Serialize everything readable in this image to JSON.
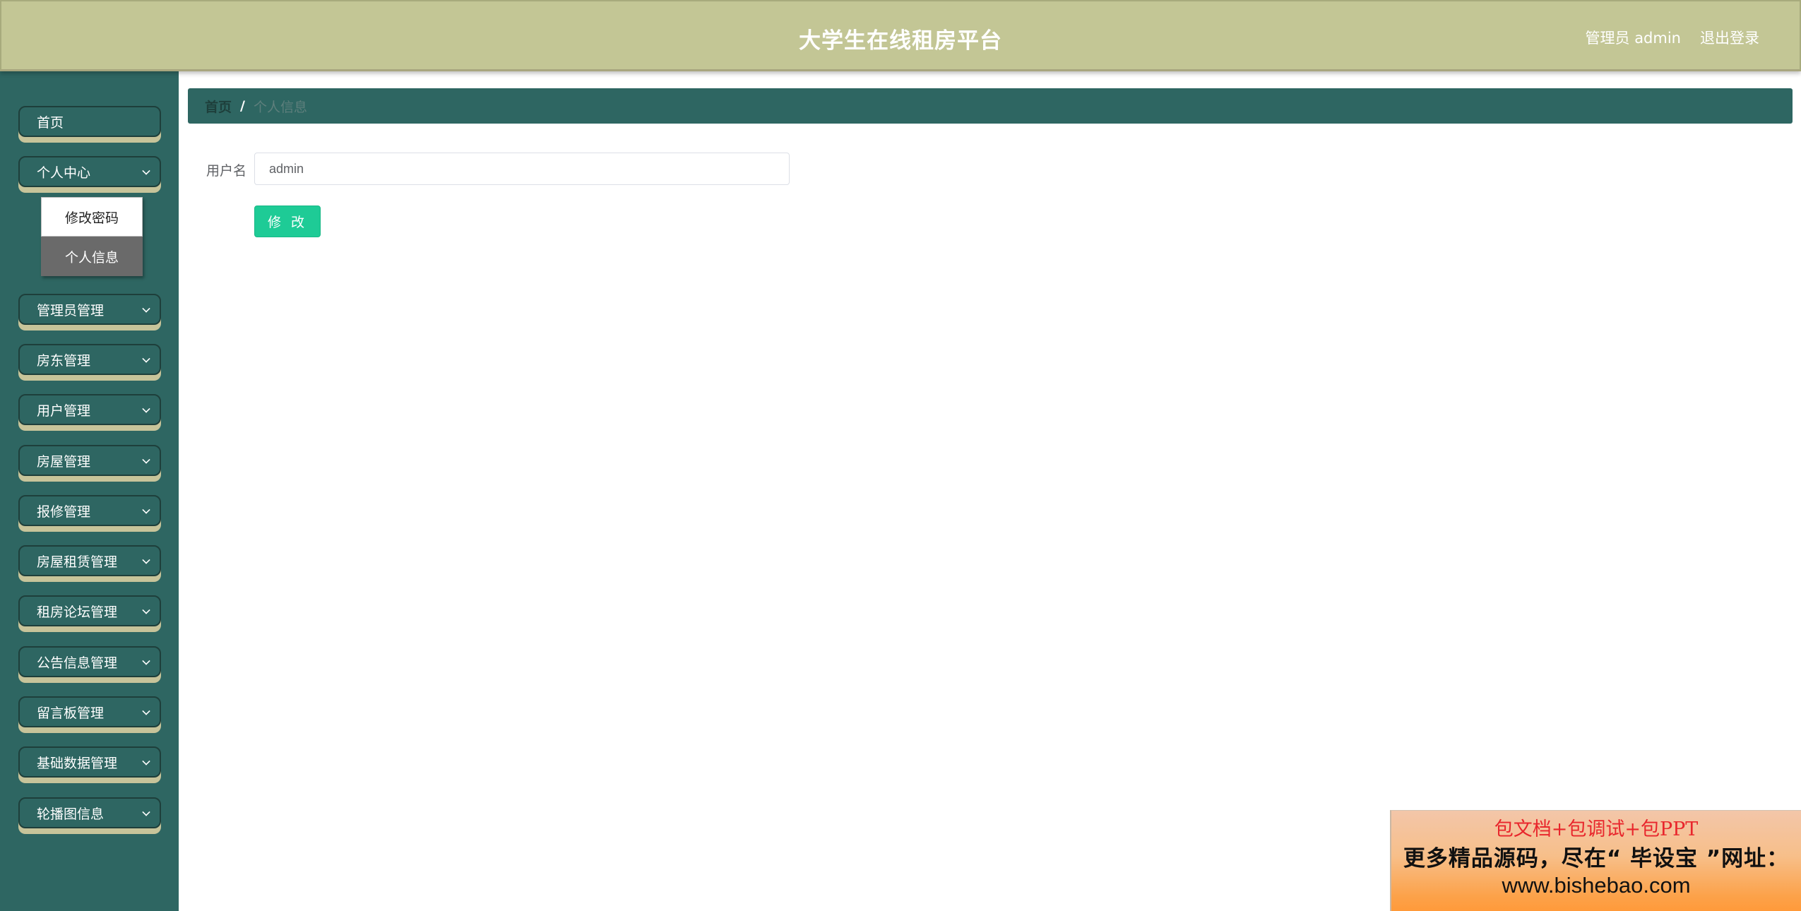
{
  "header": {
    "title": "大学生在线租房平台",
    "admin_label": "管理员 admin",
    "logout_label": "退出登录"
  },
  "sidebar": {
    "items": [
      {
        "label": "首页",
        "has_chevron": false
      },
      {
        "label": "个人中心",
        "has_chevron": true,
        "expanded": true
      },
      {
        "label": "管理员管理",
        "has_chevron": true
      },
      {
        "label": "房东管理",
        "has_chevron": true
      },
      {
        "label": "用户管理",
        "has_chevron": true
      },
      {
        "label": "房屋管理",
        "has_chevron": true
      },
      {
        "label": "报修管理",
        "has_chevron": true
      },
      {
        "label": "房屋租赁管理",
        "has_chevron": true
      },
      {
        "label": "租房论坛管理",
        "has_chevron": true
      },
      {
        "label": "公告信息管理",
        "has_chevron": true
      },
      {
        "label": "留言板管理",
        "has_chevron": true
      },
      {
        "label": "基础数据管理",
        "has_chevron": true
      },
      {
        "label": "轮播图信息",
        "has_chevron": true
      }
    ],
    "submenu": [
      {
        "label": "修改密码",
        "active": true
      },
      {
        "label": "个人信息",
        "active": false
      }
    ]
  },
  "breadcrumb": {
    "home": "首页",
    "separator": "/",
    "current": "个人信息"
  },
  "form": {
    "username_label": "用户名",
    "username_value": "admin",
    "submit_label": "修 改"
  },
  "ad": {
    "line1": "包文档+包调试+包PPT",
    "line2": "更多精品源码，尽在“ 毕设宝 ”网址：",
    "line3": "www.bishebao.com"
  },
  "colors": {
    "header_bg": "#c3c695",
    "sidebar_bg": "#2e6662",
    "accent_shadow": "#c7c49a",
    "primary_button": "#1ecb96"
  }
}
